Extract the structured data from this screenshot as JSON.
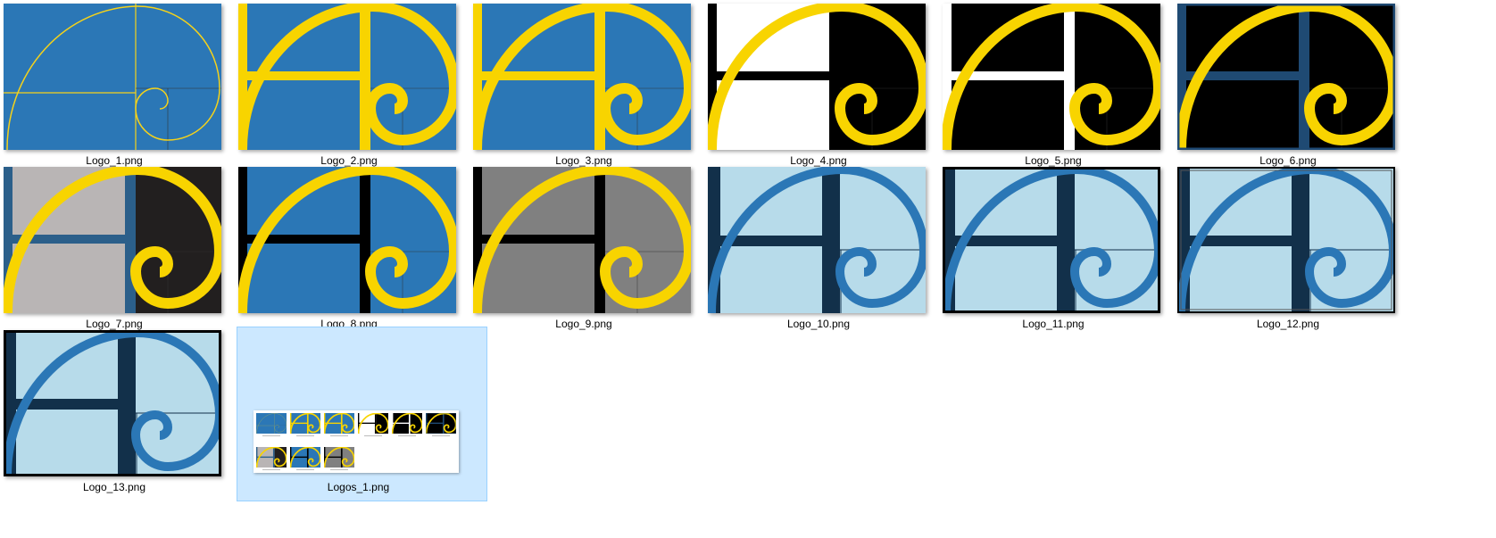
{
  "files": [
    {
      "name": "Logo_1.png",
      "style": "outline",
      "bg": "#2b77b6",
      "accent": "#f5d21a",
      "bar": "#f5d21a",
      "right": "#2b77b6",
      "border": "none"
    },
    {
      "name": "Logo_2.png",
      "style": "bold",
      "bg": "#2b77b6",
      "accent": "#f8d400",
      "bar": "#f8d400",
      "right": "#2b77b6",
      "border": "none"
    },
    {
      "name": "Logo_3.png",
      "style": "bold",
      "bg": "#2b77b6",
      "accent": "#f8d400",
      "bar": "#f8d400",
      "right": "#2b77b6",
      "border": "none"
    },
    {
      "name": "Logo_4.png",
      "style": "bold",
      "bg": "#ffffff",
      "accent": "#f8d400",
      "bar": "#000000",
      "right": "#000000",
      "border": "none"
    },
    {
      "name": "Logo_5.png",
      "style": "bold",
      "bg": "#000000",
      "accent": "#f8d400",
      "bar": "#ffffff",
      "right": "#000000",
      "border": "none"
    },
    {
      "name": "Logo_6.png",
      "style": "bold",
      "bg": "#000000",
      "accent": "#f8d400",
      "bar": "#1f4a73",
      "right": "#000000",
      "border": "navy"
    },
    {
      "name": "Logo_7.png",
      "style": "bold",
      "bg": "#b9b5b5",
      "accent": "#f8d400",
      "bar": "#2b5f8a",
      "right": "#221f1f",
      "border": "none"
    },
    {
      "name": "Logo_8.png",
      "style": "bold",
      "bg": "#2b77b6",
      "accent": "#f8d400",
      "bar": "#000000",
      "right": "#2b77b6",
      "border": "none"
    },
    {
      "name": "Logo_9.png",
      "style": "bold",
      "bg": "#808080",
      "accent": "#f8d400",
      "bar": "#000000",
      "right": "#808080",
      "border": "none"
    },
    {
      "name": "Logo_10.png",
      "style": "light",
      "bg": "#b7dbea",
      "accent": "#2b77b6",
      "bar": "#12304a",
      "right": "#b7dbea",
      "border": "none"
    },
    {
      "name": "Logo_11.png",
      "style": "light",
      "bg": "#b7dbea",
      "accent": "#2b77b6",
      "bar": "#12304a",
      "right": "#b7dbea",
      "border": "black"
    },
    {
      "name": "Logo_12.png",
      "style": "light",
      "bg": "#b7dbea",
      "accent": "#2b77b6",
      "bar": "#12304a",
      "right": "#b7dbea",
      "border": "double"
    },
    {
      "name": "Logo_13.png",
      "style": "light",
      "bg": "#b7dbea",
      "accent": "#2b77b6",
      "bar": "#12304a",
      "right": "#b7dbea",
      "border": "black"
    },
    {
      "name": "Logos_1.png",
      "style": "contact",
      "bg": "#ffffff",
      "accent": "#f8d400",
      "bar": "#000000",
      "right": "#ffffff",
      "border": "none",
      "selected": true
    }
  ]
}
